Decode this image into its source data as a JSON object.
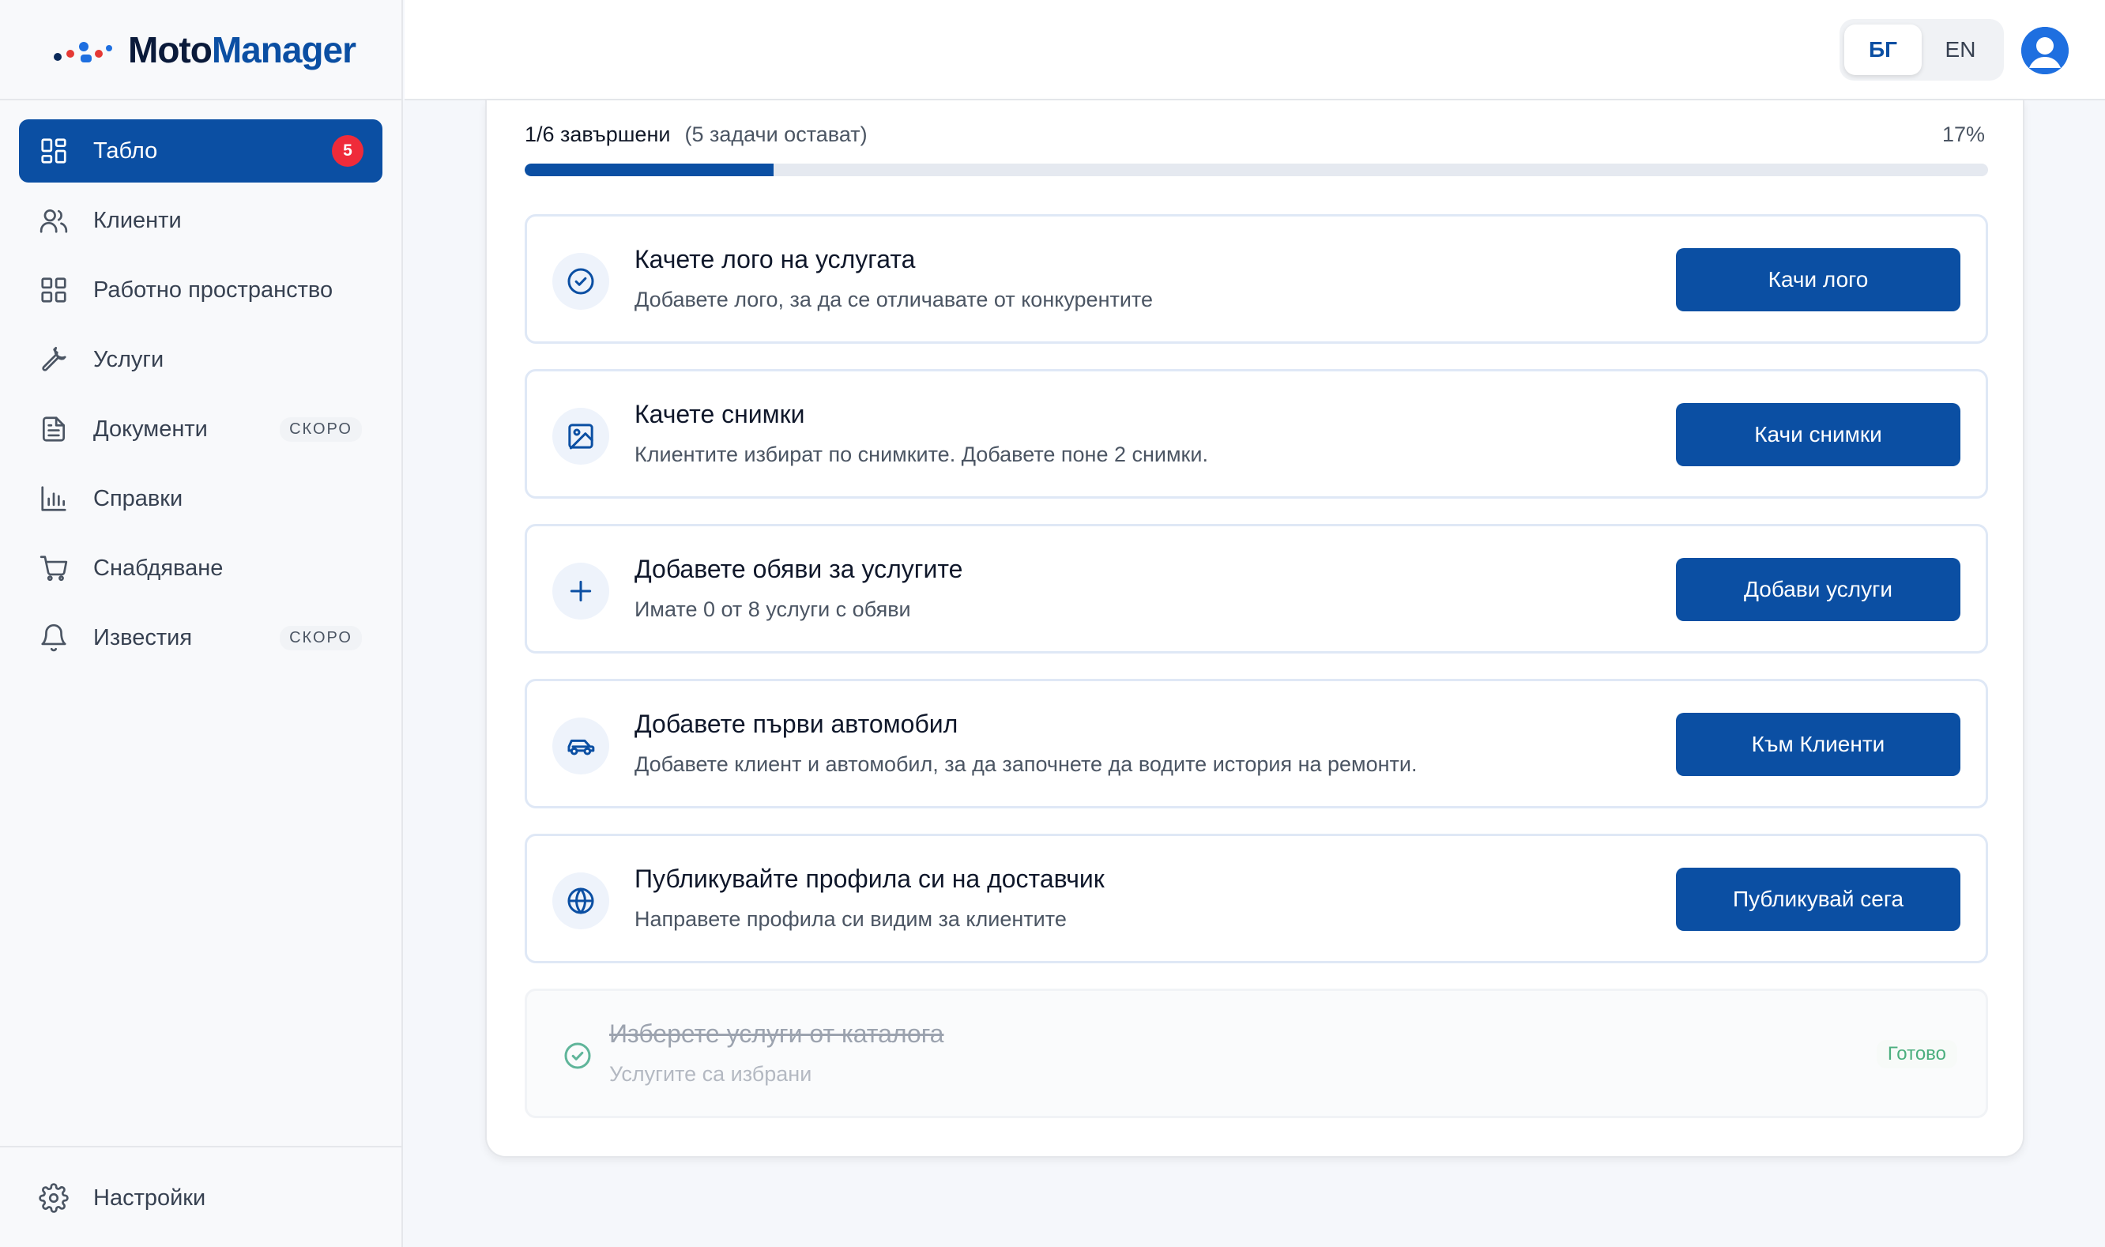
{
  "brand": {
    "name_part1": "Moto",
    "name_part2": "Manager"
  },
  "colors": {
    "primary": "#0b4fa3",
    "badge": "#ef2b3a",
    "done": "#4caf7f"
  },
  "sidebar": {
    "items": [
      {
        "label": "Табло",
        "icon": "dashboard-icon",
        "badge": "5",
        "active": true
      },
      {
        "label": "Клиенти",
        "icon": "users-icon"
      },
      {
        "label": "Работно пространство",
        "icon": "workspace-icon"
      },
      {
        "label": "Услуги",
        "icon": "wrench-icon"
      },
      {
        "label": "Документи",
        "icon": "document-icon",
        "tag": "СКОРО"
      },
      {
        "label": "Справки",
        "icon": "chart-icon"
      },
      {
        "label": "Снабдяване",
        "icon": "cart-icon"
      },
      {
        "label": "Известия",
        "icon": "bell-icon",
        "tag": "СКОРО"
      }
    ],
    "footer": {
      "label": "Настройки",
      "icon": "gear-icon"
    }
  },
  "topbar": {
    "languages": [
      {
        "label": "БГ",
        "active": true
      },
      {
        "label": "EN",
        "active": false
      }
    ]
  },
  "progress": {
    "done_text": "1/6 завършени",
    "remaining_text": "(5 задачи остават)",
    "percent_text": "17%",
    "fraction": 0.17
  },
  "tasks": [
    {
      "title": "Качете лого на услугата",
      "desc": "Добавете лого, за да се отличавате от конкурентите",
      "button": "Качи лого",
      "icon": "check-circle-icon"
    },
    {
      "title": "Качете снимки",
      "desc": "Клиентите избират по снимките. Добавете поне 2 снимки.",
      "button": "Качи снимки",
      "icon": "image-icon"
    },
    {
      "title": "Добавете обяви за услугите",
      "desc": "Имате 0 от 8 услуги с обяви",
      "button": "Добави услуги",
      "icon": "plus-icon"
    },
    {
      "title": "Добавете първи автомобил",
      "desc": "Добавете клиент и автомобил, за да започнете да водите история на ремонти.",
      "button": "Към Клиенти",
      "icon": "car-icon"
    },
    {
      "title": "Публикувайте профила си на доставчик",
      "desc": "Направете профила си видим за клиентите",
      "button": "Публикувай сега",
      "icon": "globe-icon"
    }
  ],
  "completed_task": {
    "title": "Изберете услуги от каталога",
    "desc": "Услугите са избрани",
    "status": "Готово",
    "icon": "check-circle-icon"
  }
}
